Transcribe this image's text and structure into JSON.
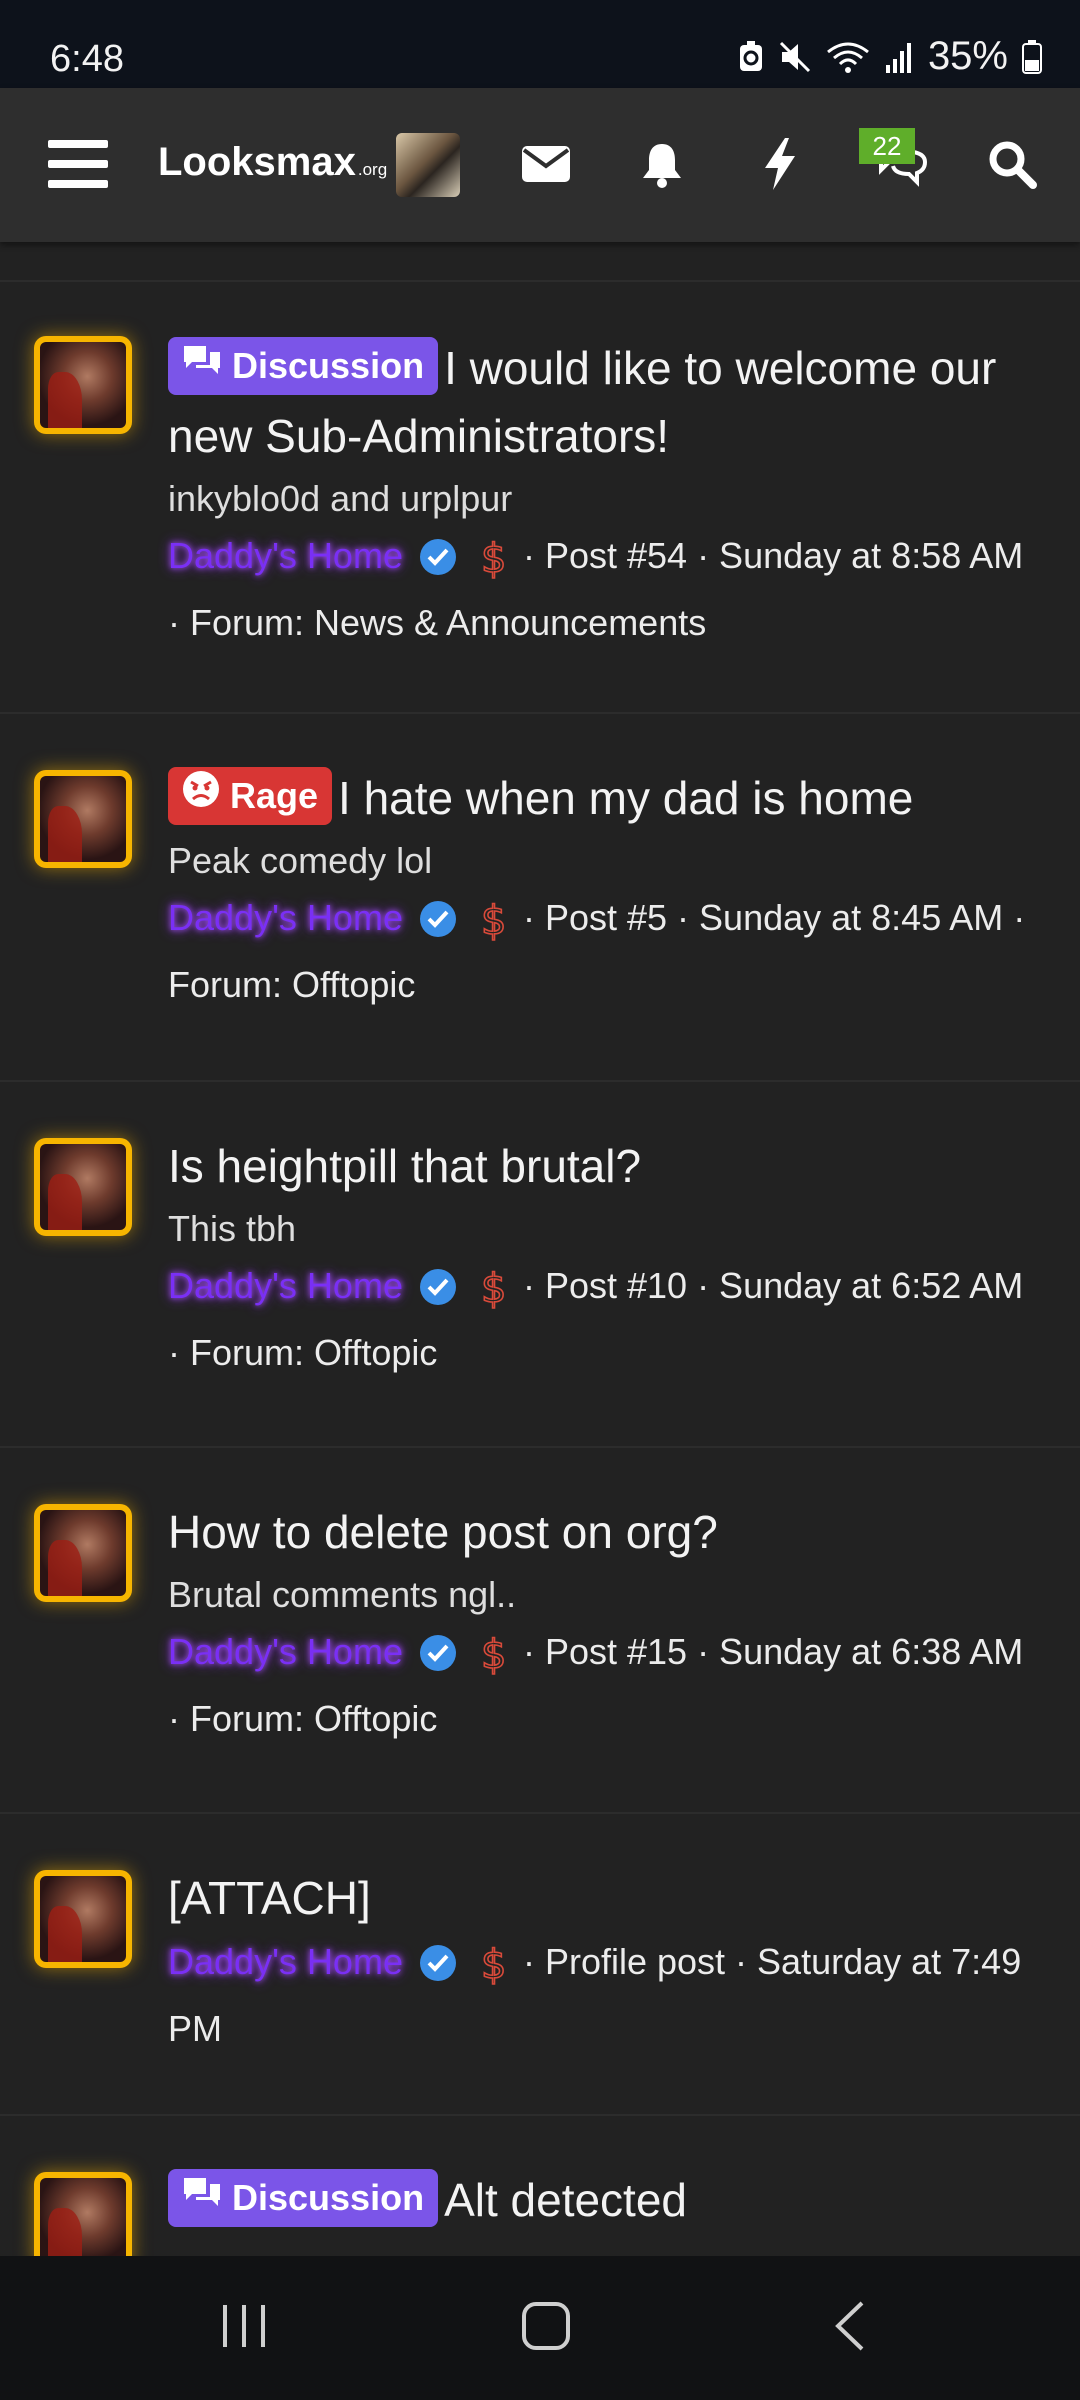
{
  "status": {
    "time": "6:48",
    "battery": "35%"
  },
  "header": {
    "logo": "Looksmax",
    "logo_suffix": ".org",
    "conversations_count": "22"
  },
  "colors": {
    "accent_discussion": "#7b55e8",
    "accent_rage": "#d83634",
    "avatar_glow": "#f7b500",
    "username": "#7a2ff5"
  },
  "feed": {
    "items": [
      {
        "prefix": "Discussion",
        "title": "I would like to welcome our new Sub-Administrators!",
        "snippet": "inkyblo0d and urplpur",
        "user": "Daddy's Home",
        "meta": "· Post #54 · Sunday at 8:58 AM · Forum: News & Announcements"
      },
      {
        "prefix": "Rage",
        "title": "I hate when my dad is home",
        "snippet": "Peak comedy lol",
        "user": "Daddy's Home",
        "meta": "· Post #5 · Sunday at 8:45 AM · Forum: Offtopic"
      },
      {
        "title": "Is heightpill that brutal?",
        "snippet": "This tbh",
        "user": "Daddy's Home",
        "meta": "· Post #10 · Sunday at 6:52 AM · Forum: Offtopic"
      },
      {
        "title": "How to delete post on org?",
        "snippet": "Brutal comments ngl..",
        "user": "Daddy's Home",
        "meta": "· Post #15 · Sunday at 6:38 AM · Forum: Offtopic"
      },
      {
        "title": "[ATTACH]",
        "user": "Daddy's Home",
        "meta": "· Profile post · Saturday at 7:49 PM"
      },
      {
        "prefix": "Discussion",
        "title": "Alt detected"
      }
    ]
  },
  "icons": {
    "menu": "menu-icon",
    "mail": "mail-icon",
    "bell": "bell-icon",
    "bolt": "bolt-icon",
    "conversations": "conversations-icon",
    "search": "search-icon"
  }
}
